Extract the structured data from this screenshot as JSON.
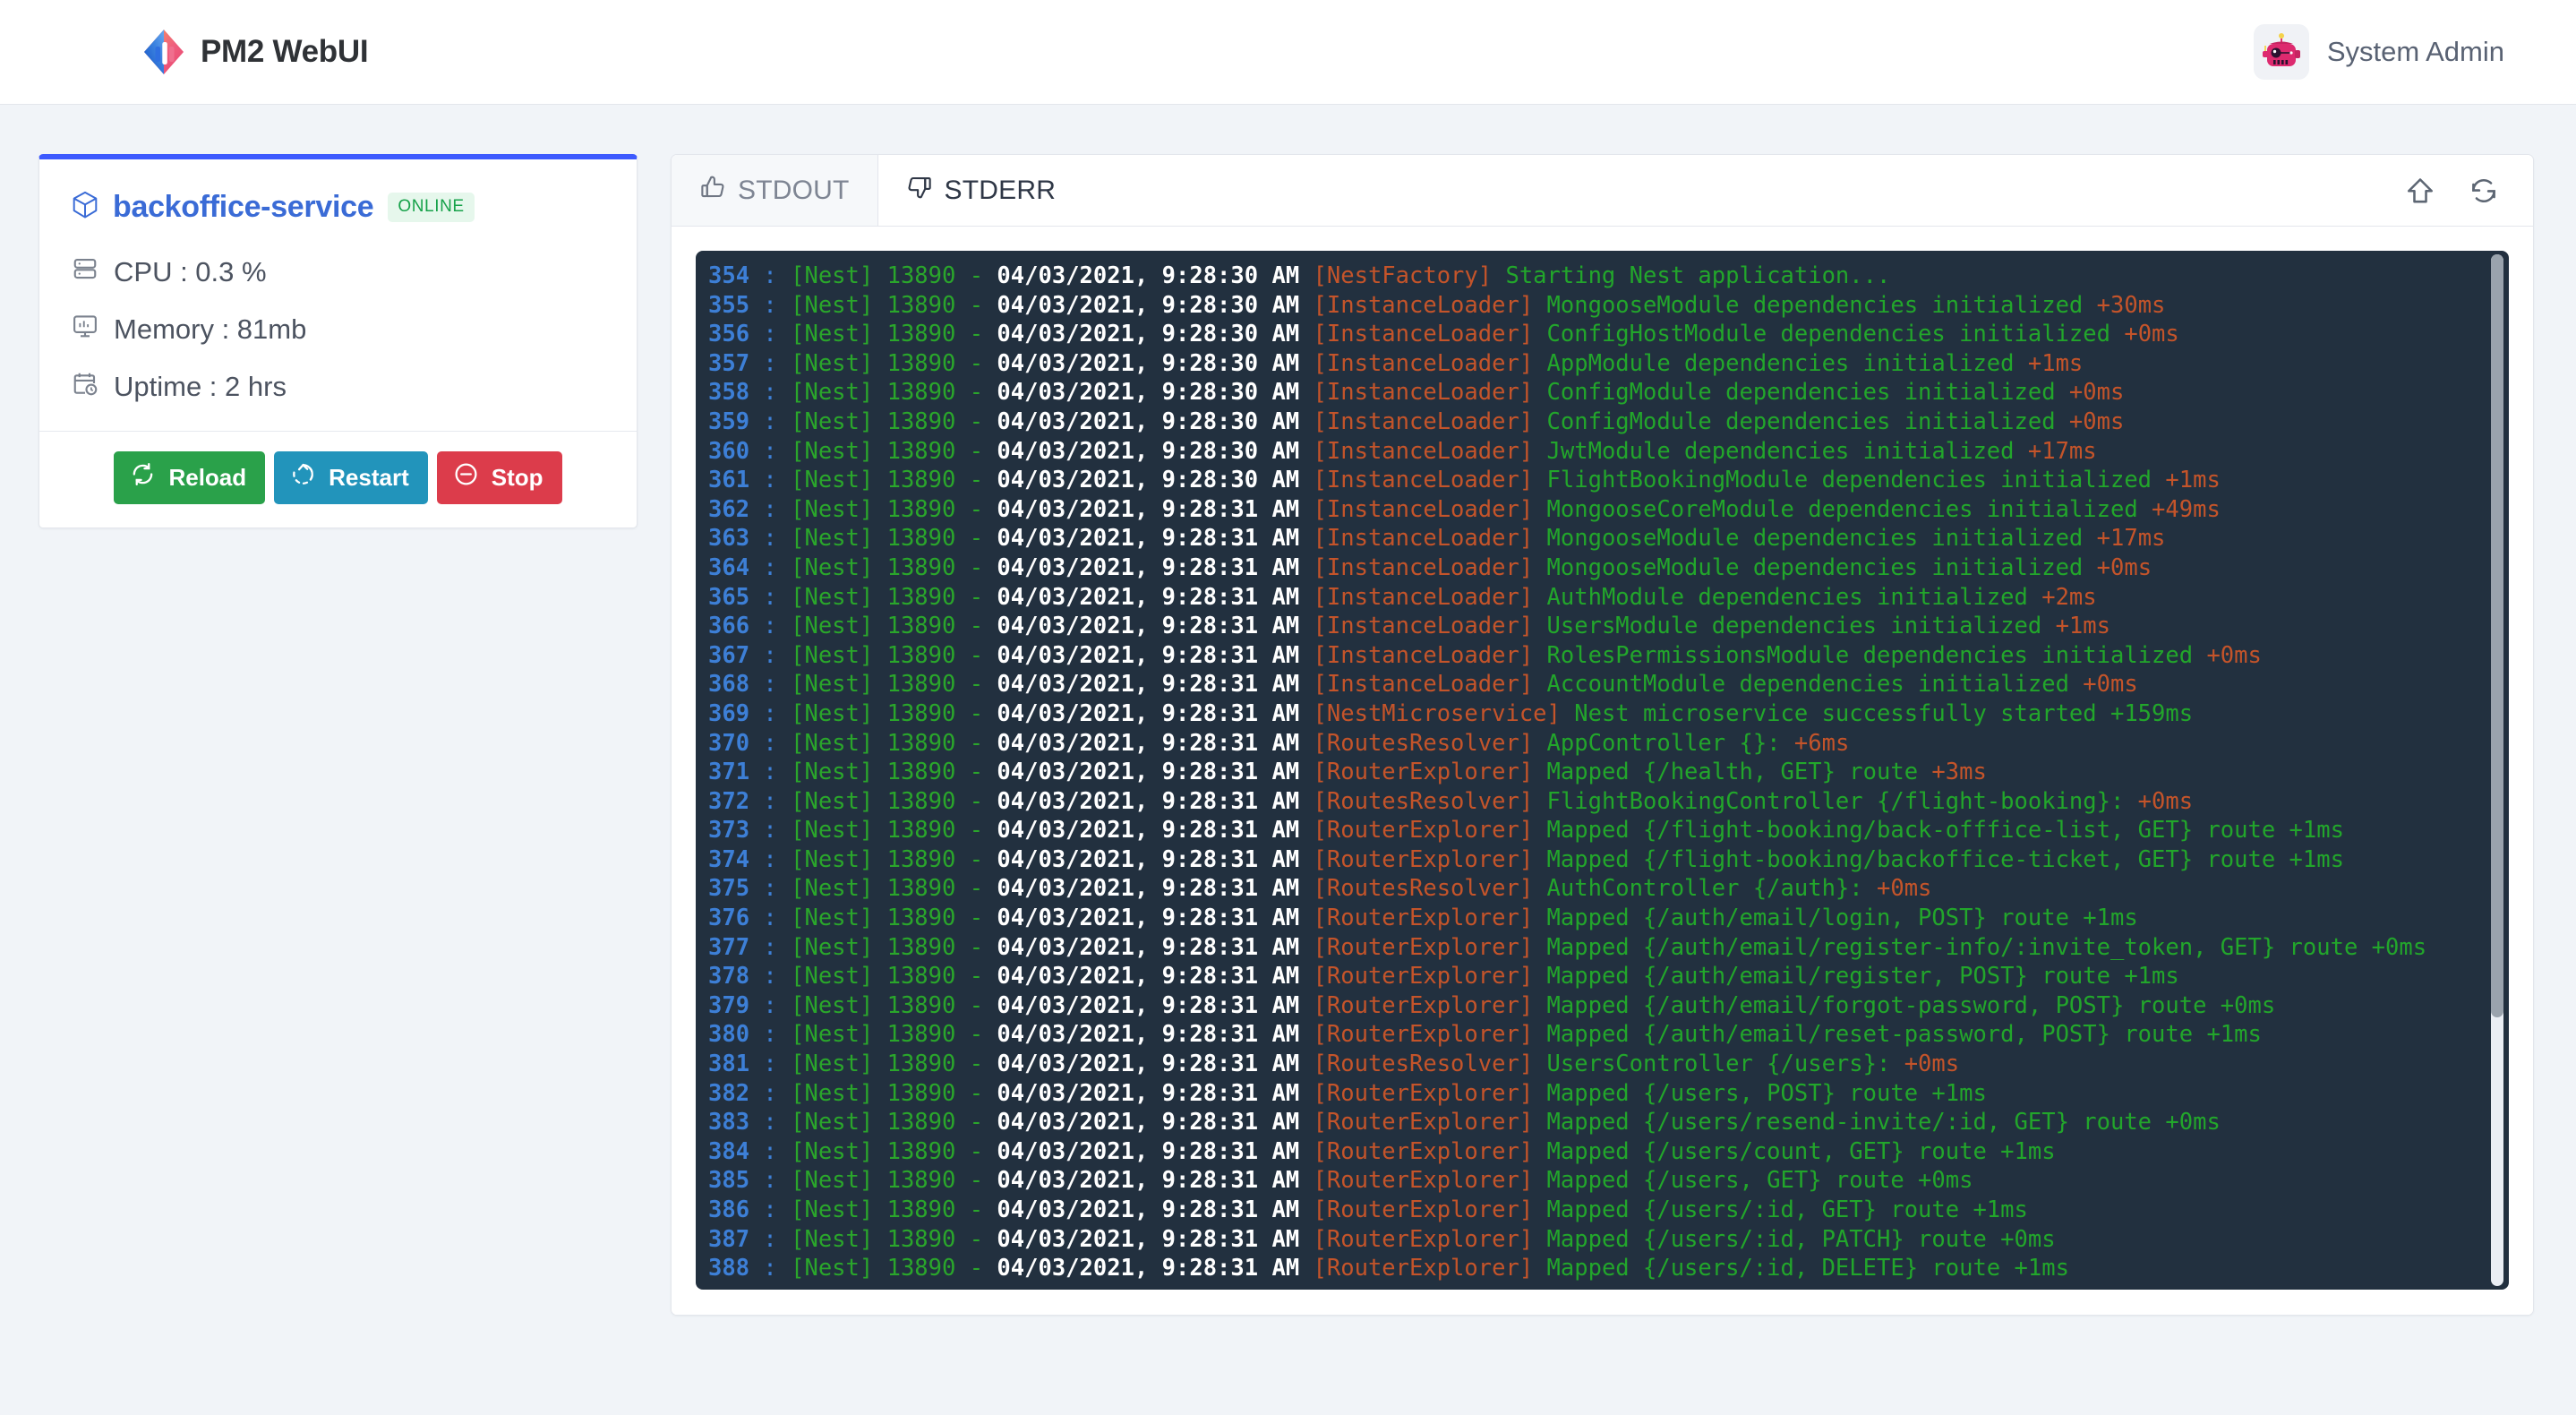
{
  "header": {
    "brand_name": "PM2 WebUI",
    "logo_icon": "pm2-diamond-logo",
    "user_name": "System Admin",
    "avatar_icon": "robot-avatar-icon"
  },
  "process_card": {
    "name": "backoffice-service",
    "name_icon": "cube-icon",
    "status_badge": "ONLINE",
    "stats": [
      {
        "icon": "server-icon",
        "label": "CPU : 0.3 %"
      },
      {
        "icon": "monitor-icon",
        "label": "Memory : 81mb"
      },
      {
        "icon": "calendar-clock-icon",
        "label": "Uptime : 2 hrs"
      }
    ],
    "buttons": [
      {
        "label": "Reload",
        "icon": "refresh-icon",
        "color": "#2aa14a"
      },
      {
        "label": "Restart",
        "icon": "restart-icon",
        "color": "#2294bb"
      },
      {
        "label": "Stop",
        "icon": "minus-circle-icon",
        "color": "#dc3c4b"
      }
    ],
    "accent_color": "#3d5afe"
  },
  "log_panel": {
    "tabs": [
      {
        "label": "STDOUT",
        "icon": "thumbs-up-icon",
        "active": true
      },
      {
        "label": "STDERR",
        "icon": "thumbs-down-icon",
        "active": false
      }
    ],
    "tools": [
      {
        "icon": "arrow-up-icon"
      },
      {
        "icon": "refresh-icon"
      }
    ],
    "terminal_bg": "#22303f",
    "colors": {
      "line_number": "#3d7fd6",
      "prefix": "#2aa62b",
      "timestamp": "#ffffff",
      "context": "#c4542a",
      "message": "#22a62b",
      "timing": "#c4542a"
    },
    "lines": [
      {
        "n": "354",
        "pid": "[Nest] 13890 -",
        "ts": "04/03/2021, 9:28:30 AM",
        "ctx": "[NestFactory]",
        "msg": "Starting Nest application...",
        "ms": ""
      },
      {
        "n": "355",
        "pid": "[Nest] 13890 -",
        "ts": "04/03/2021, 9:28:30 AM",
        "ctx": "[InstanceLoader]",
        "msg": "MongooseModule dependencies initialized",
        "ms": "+30ms"
      },
      {
        "n": "356",
        "pid": "[Nest] 13890 -",
        "ts": "04/03/2021, 9:28:30 AM",
        "ctx": "[InstanceLoader]",
        "msg": "ConfigHostModule dependencies initialized",
        "ms": "+0ms"
      },
      {
        "n": "357",
        "pid": "[Nest] 13890 -",
        "ts": "04/03/2021, 9:28:30 AM",
        "ctx": "[InstanceLoader]",
        "msg": "AppModule dependencies initialized",
        "ms": "+1ms"
      },
      {
        "n": "358",
        "pid": "[Nest] 13890 -",
        "ts": "04/03/2021, 9:28:30 AM",
        "ctx": "[InstanceLoader]",
        "msg": "ConfigModule dependencies initialized",
        "ms": "+0ms"
      },
      {
        "n": "359",
        "pid": "[Nest] 13890 -",
        "ts": "04/03/2021, 9:28:30 AM",
        "ctx": "[InstanceLoader]",
        "msg": "ConfigModule dependencies initialized",
        "ms": "+0ms"
      },
      {
        "n": "360",
        "pid": "[Nest] 13890 -",
        "ts": "04/03/2021, 9:28:30 AM",
        "ctx": "[InstanceLoader]",
        "msg": "JwtModule dependencies initialized",
        "ms": "+17ms"
      },
      {
        "n": "361",
        "pid": "[Nest] 13890 -",
        "ts": "04/03/2021, 9:28:30 AM",
        "ctx": "[InstanceLoader]",
        "msg": "FlightBookingModule dependencies initialized",
        "ms": "+1ms"
      },
      {
        "n": "362",
        "pid": "[Nest] 13890 -",
        "ts": "04/03/2021, 9:28:31 AM",
        "ctx": "[InstanceLoader]",
        "msg": "MongooseCoreModule dependencies initialized",
        "ms": "+49ms"
      },
      {
        "n": "363",
        "pid": "[Nest] 13890 -",
        "ts": "04/03/2021, 9:28:31 AM",
        "ctx": "[InstanceLoader]",
        "msg": "MongooseModule dependencies initialized",
        "ms": "+17ms"
      },
      {
        "n": "364",
        "pid": "[Nest] 13890 -",
        "ts": "04/03/2021, 9:28:31 AM",
        "ctx": "[InstanceLoader]",
        "msg": "MongooseModule dependencies initialized",
        "ms": "+0ms"
      },
      {
        "n": "365",
        "pid": "[Nest] 13890 -",
        "ts": "04/03/2021, 9:28:31 AM",
        "ctx": "[InstanceLoader]",
        "msg": "AuthModule dependencies initialized",
        "ms": "+2ms"
      },
      {
        "n": "366",
        "pid": "[Nest] 13890 -",
        "ts": "04/03/2021, 9:28:31 AM",
        "ctx": "[InstanceLoader]",
        "msg": "UsersModule dependencies initialized",
        "ms": "+1ms"
      },
      {
        "n": "367",
        "pid": "[Nest] 13890 -",
        "ts": "04/03/2021, 9:28:31 AM",
        "ctx": "[InstanceLoader]",
        "msg": "RolesPermissionsModule dependencies initialized",
        "ms": "+0ms"
      },
      {
        "n": "368",
        "pid": "[Nest] 13890 -",
        "ts": "04/03/2021, 9:28:31 AM",
        "ctx": "[InstanceLoader]",
        "msg": "AccountModule dependencies initialized",
        "ms": "+0ms"
      },
      {
        "n": "369",
        "pid": "[Nest] 13890 -",
        "ts": "04/03/2021, 9:28:31 AM",
        "ctx": "[NestMicroservice]",
        "msg": "Nest microservice successfully started +159ms",
        "ms": ""
      },
      {
        "n": "370",
        "pid": "[Nest] 13890 -",
        "ts": "04/03/2021, 9:28:31 AM",
        "ctx": "[RoutesResolver]",
        "msg": "AppController {}:",
        "ms": "+6ms"
      },
      {
        "n": "371",
        "pid": "[Nest] 13890 -",
        "ts": "04/03/2021, 9:28:31 AM",
        "ctx": "[RouterExplorer]",
        "msg": "Mapped {/health, GET} route",
        "ms": "+3ms"
      },
      {
        "n": "372",
        "pid": "[Nest] 13890 -",
        "ts": "04/03/2021, 9:28:31 AM",
        "ctx": "[RoutesResolver]",
        "msg": "FlightBookingController {/flight-booking}:",
        "ms": "+0ms"
      },
      {
        "n": "373",
        "pid": "[Nest] 13890 -",
        "ts": "04/03/2021, 9:28:31 AM",
        "ctx": "[RouterExplorer]",
        "msg": "Mapped {/flight-booking/back-offfice-list, GET} route +1ms",
        "ms": ""
      },
      {
        "n": "374",
        "pid": "[Nest] 13890 -",
        "ts": "04/03/2021, 9:28:31 AM",
        "ctx": "[RouterExplorer]",
        "msg": "Mapped {/flight-booking/backoffice-ticket, GET} route +1ms",
        "ms": ""
      },
      {
        "n": "375",
        "pid": "[Nest] 13890 -",
        "ts": "04/03/2021, 9:28:31 AM",
        "ctx": "[RoutesResolver]",
        "msg": "AuthController {/auth}:",
        "ms": "+0ms"
      },
      {
        "n": "376",
        "pid": "[Nest] 13890 -",
        "ts": "04/03/2021, 9:28:31 AM",
        "ctx": "[RouterExplorer]",
        "msg": "Mapped {/auth/email/login, POST} route +1ms",
        "ms": ""
      },
      {
        "n": "377",
        "pid": "[Nest] 13890 -",
        "ts": "04/03/2021, 9:28:31 AM",
        "ctx": "[RouterExplorer]",
        "msg": "Mapped {/auth/email/register-info/:invite_token, GET} route +0ms",
        "ms": ""
      },
      {
        "n": "378",
        "pid": "[Nest] 13890 -",
        "ts": "04/03/2021, 9:28:31 AM",
        "ctx": "[RouterExplorer]",
        "msg": "Mapped {/auth/email/register, POST} route +1ms",
        "ms": ""
      },
      {
        "n": "379",
        "pid": "[Nest] 13890 -",
        "ts": "04/03/2021, 9:28:31 AM",
        "ctx": "[RouterExplorer]",
        "msg": "Mapped {/auth/email/forgot-password, POST} route +0ms",
        "ms": ""
      },
      {
        "n": "380",
        "pid": "[Nest] 13890 -",
        "ts": "04/03/2021, 9:28:31 AM",
        "ctx": "[RouterExplorer]",
        "msg": "Mapped {/auth/email/reset-password, POST} route +1ms",
        "ms": ""
      },
      {
        "n": "381",
        "pid": "[Nest] 13890 -",
        "ts": "04/03/2021, 9:28:31 AM",
        "ctx": "[RoutesResolver]",
        "msg": "UsersController {/users}:",
        "ms": "+0ms"
      },
      {
        "n": "382",
        "pid": "[Nest] 13890 -",
        "ts": "04/03/2021, 9:28:31 AM",
        "ctx": "[RouterExplorer]",
        "msg": "Mapped {/users, POST} route +1ms",
        "ms": ""
      },
      {
        "n": "383",
        "pid": "[Nest] 13890 -",
        "ts": "04/03/2021, 9:28:31 AM",
        "ctx": "[RouterExplorer]",
        "msg": "Mapped {/users/resend-invite/:id, GET} route +0ms",
        "ms": ""
      },
      {
        "n": "384",
        "pid": "[Nest] 13890 -",
        "ts": "04/03/2021, 9:28:31 AM",
        "ctx": "[RouterExplorer]",
        "msg": "Mapped {/users/count, GET} route +1ms",
        "ms": ""
      },
      {
        "n": "385",
        "pid": "[Nest] 13890 -",
        "ts": "04/03/2021, 9:28:31 AM",
        "ctx": "[RouterExplorer]",
        "msg": "Mapped {/users, GET} route +0ms",
        "ms": ""
      },
      {
        "n": "386",
        "pid": "[Nest] 13890 -",
        "ts": "04/03/2021, 9:28:31 AM",
        "ctx": "[RouterExplorer]",
        "msg": "Mapped {/users/:id, GET} route +1ms",
        "ms": ""
      },
      {
        "n": "387",
        "pid": "[Nest] 13890 -",
        "ts": "04/03/2021, 9:28:31 AM",
        "ctx": "[RouterExplorer]",
        "msg": "Mapped {/users/:id, PATCH} route +0ms",
        "ms": ""
      },
      {
        "n": "388",
        "pid": "[Nest] 13890 -",
        "ts": "04/03/2021, 9:28:31 AM",
        "ctx": "[RouterExplorer]",
        "msg": "Mapped {/users/:id, DELETE} route +1ms",
        "ms": ""
      }
    ]
  }
}
